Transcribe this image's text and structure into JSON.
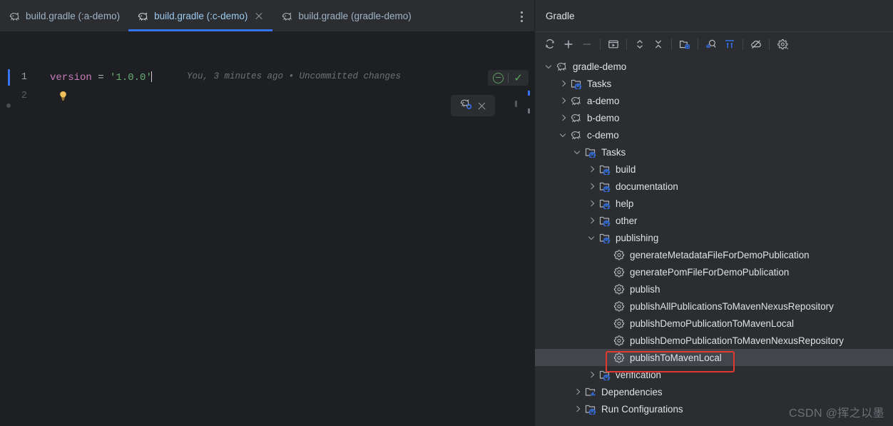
{
  "window": {
    "theme_bg": "#1e1f22",
    "panel_bg": "#2b2d30",
    "accent": "#3574f0",
    "selection_bg": "#43454a",
    "annotation_color": "#e03a30"
  },
  "editor": {
    "tabs": [
      {
        "label": "build.gradle (:a-demo)",
        "icon": "gradle-elephant-icon",
        "active": false,
        "closable": false
      },
      {
        "label": "build.gradle (:c-demo)",
        "icon": "gradle-elephant-icon",
        "active": true,
        "closable": true
      },
      {
        "label": "build.gradle (gradle-demo)",
        "icon": "gradle-elephant-icon",
        "active": false,
        "closable": false
      }
    ],
    "tab_options_icon": "more-vertical-icon",
    "lines": [
      {
        "number": "1",
        "tokens": [
          {
            "text": "version",
            "kind": "keyword"
          },
          {
            "text": " = ",
            "kind": "operator"
          },
          {
            "text": "'1.0.0'",
            "kind": "string"
          }
        ]
      },
      {
        "number": "2",
        "tokens": []
      }
    ],
    "blame_hint": "You, 3 minutes ago • Uncommitted changes",
    "intention_bulb_icon": "lightbulb-icon",
    "inspection_widget": {
      "hector_icon": "inspections-level-icon",
      "status_icon": "analysis-ok-checkmark-icon"
    },
    "floating_notification": {
      "icon": "gradle-reload-changes-icon",
      "close_icon": "close-icon"
    }
  },
  "gradle_panel": {
    "title": "Gradle",
    "toolbar": [
      {
        "name": "reload-all-gradle-projects-icon",
        "enabled": true
      },
      {
        "name": "link-gradle-project-plus-icon",
        "enabled": true
      },
      {
        "name": "detach-gradle-project-minus-icon",
        "enabled": false
      },
      {
        "name": "execute-gradle-task-icon",
        "enabled": true
      },
      {
        "name": "expand-all-icon",
        "enabled": true
      },
      {
        "name": "collapse-all-icon",
        "enabled": true
      },
      {
        "name": "attach-gradle-project-folder-icon",
        "enabled": true
      },
      {
        "name": "run-with-profiler-icon",
        "enabled": true
      },
      {
        "name": "download-sources-icon",
        "enabled": true
      },
      {
        "name": "toggle-offline-mode-icon",
        "enabled": true
      },
      {
        "name": "gradle-settings-gear-icon",
        "enabled": true
      }
    ],
    "tree": [
      {
        "label": "gradle-demo",
        "depth": 0,
        "state": "open",
        "icon": "gradle-elephant-icon"
      },
      {
        "label": "Tasks",
        "depth": 1,
        "state": "closed",
        "icon": "tasks-folder-icon"
      },
      {
        "label": "a-demo",
        "depth": 1,
        "state": "closed",
        "icon": "gradle-elephant-icon"
      },
      {
        "label": "b-demo",
        "depth": 1,
        "state": "closed",
        "icon": "gradle-elephant-icon"
      },
      {
        "label": "c-demo",
        "depth": 1,
        "state": "open",
        "icon": "gradle-elephant-icon"
      },
      {
        "label": "Tasks",
        "depth": 2,
        "state": "open",
        "icon": "tasks-folder-icon"
      },
      {
        "label": "build",
        "depth": 3,
        "state": "closed",
        "icon": "tasks-folder-icon"
      },
      {
        "label": "documentation",
        "depth": 3,
        "state": "closed",
        "icon": "tasks-folder-icon"
      },
      {
        "label": "help",
        "depth": 3,
        "state": "closed",
        "icon": "tasks-folder-icon"
      },
      {
        "label": "other",
        "depth": 3,
        "state": "closed",
        "icon": "tasks-folder-icon"
      },
      {
        "label": "publishing",
        "depth": 3,
        "state": "open",
        "icon": "tasks-folder-icon"
      },
      {
        "label": "generateMetadataFileForDemoPublication",
        "depth": 4,
        "state": "leaf",
        "icon": "gradle-task-gear-icon"
      },
      {
        "label": "generatePomFileForDemoPublication",
        "depth": 4,
        "state": "leaf",
        "icon": "gradle-task-gear-icon"
      },
      {
        "label": "publish",
        "depth": 4,
        "state": "leaf",
        "icon": "gradle-task-gear-icon"
      },
      {
        "label": "publishAllPublicationsToMavenNexusRepository",
        "depth": 4,
        "state": "leaf",
        "icon": "gradle-task-gear-icon"
      },
      {
        "label": "publishDemoPublicationToMavenLocal",
        "depth": 4,
        "state": "leaf",
        "icon": "gradle-task-gear-icon"
      },
      {
        "label": "publishDemoPublicationToMavenNexusRepository",
        "depth": 4,
        "state": "leaf",
        "icon": "gradle-task-gear-icon"
      },
      {
        "label": "publishToMavenLocal",
        "depth": 4,
        "state": "leaf",
        "icon": "gradle-task-gear-icon",
        "selected": true,
        "annotated": true
      },
      {
        "label": "verification",
        "depth": 3,
        "state": "closed",
        "icon": "tasks-folder-icon"
      },
      {
        "label": "Dependencies",
        "depth": 2,
        "state": "closed",
        "icon": "dependencies-folder-icon"
      },
      {
        "label": "Run Configurations",
        "depth": 2,
        "state": "closed",
        "icon": "run-configurations-folder-icon"
      }
    ]
  },
  "watermark": {
    "text": "CSDN @挥之以墨"
  }
}
